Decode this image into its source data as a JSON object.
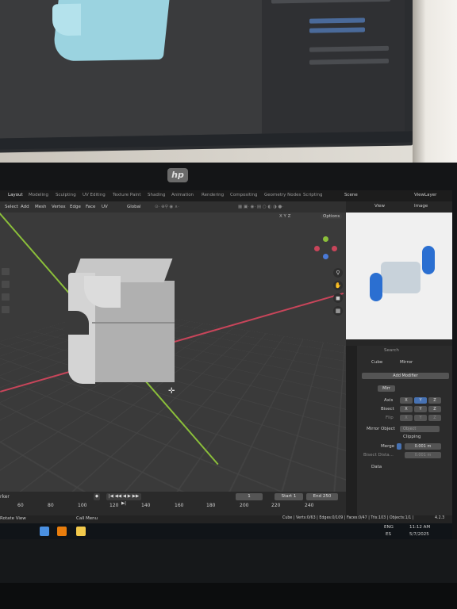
{
  "topbar": {
    "tabs": [
      "Layout",
      "Modeling",
      "Sculpting",
      "UV Editing",
      "Texture Paint",
      "Shading",
      "Animation",
      "Rendering",
      "Compositing",
      "Geometry Nodes",
      "Scripting"
    ],
    "scene": "Scene",
    "view_layer": "ViewLayer"
  },
  "toolbar": {
    "items": [
      "Select",
      "Add",
      "Mesh",
      "Vertex",
      "Edge",
      "Face",
      "UV"
    ],
    "orientation": "Global",
    "axes": "X Y Z",
    "options": "Options"
  },
  "preview": {
    "view": "View",
    "image": "Image"
  },
  "properties": {
    "search_placeholder": "Search",
    "object": "Cube",
    "modifier": "Mirror",
    "add_modifier": "Add Modifier",
    "modifier_short": "Mirr",
    "axis_label": "Axis",
    "bisect_label": "Bisect",
    "flip_label": "Flip",
    "x": "X",
    "y": "Y",
    "z": "Z",
    "mirror_object_label": "Mirror Object",
    "mirror_object_placeholder": "Object",
    "clipping_label": "Clipping",
    "merge_label": "Merge",
    "merge_value": "0.001 m",
    "bisect_distance_label": "Bisect Dista...",
    "bisect_distance_value": "0.001 m",
    "data_label": "Data"
  },
  "timeline": {
    "marker": "rker",
    "frames": [
      "60",
      "80",
      "100",
      "120",
      "140",
      "160",
      "180",
      "200",
      "220",
      "240"
    ],
    "current_frame": "1",
    "start_label": "Start",
    "start_value": "1",
    "end_label": "End",
    "end_value": "250"
  },
  "statusbar": {
    "left": "Rotate View",
    "center": "Call Menu",
    "stats": "Cube | Verts:0/63 | Edges:0/109 | Faces:0/47 | Tris:103 | Objects:1/1 |",
    "version": "4.2.3"
  },
  "taskbar": {
    "lang": "ENG",
    "region": "ES",
    "time": "11:12 AM",
    "date": "5/7/2025"
  },
  "colors": {
    "viewport_bg": "#3a3a3a",
    "accent_blue": "#4772b3",
    "x_axis": "#c8455a",
    "y_axis": "#8bbf3a"
  },
  "icons": [
    "hp-logo",
    "gizmo",
    "zoom-icon",
    "hand-icon",
    "camera-icon",
    "grid-icon",
    "wrench-icon",
    "windows-start-icon"
  ]
}
